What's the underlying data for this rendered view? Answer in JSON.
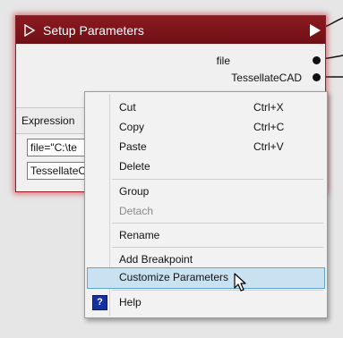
{
  "node": {
    "title": "Setup Parameters",
    "outputs": [
      "file",
      "TessellateCAD"
    ],
    "expression_label": "Expression",
    "fields": [
      "file=\"C:\\te",
      "TessellateC"
    ]
  },
  "context_menu": {
    "items": [
      {
        "label": "Cut",
        "shortcut": "Ctrl+X"
      },
      {
        "label": "Copy",
        "shortcut": "Ctrl+C"
      },
      {
        "label": "Paste",
        "shortcut": "Ctrl+V"
      },
      {
        "label": "Delete"
      },
      {
        "label": "Group"
      },
      {
        "label": "Detach",
        "disabled": true
      },
      {
        "label": "Rename"
      },
      {
        "label": "Add Breakpoint"
      },
      {
        "label": "Customize Parameters",
        "highlighted": true
      },
      {
        "label": "Help",
        "icon": "help-icon",
        "icon_glyph": "?"
      }
    ]
  },
  "colors": {
    "header": "#7a1419",
    "node_glow": "#c81e28",
    "menu_highlight": "#c8e2f2",
    "help_icon": "#1530a0"
  }
}
